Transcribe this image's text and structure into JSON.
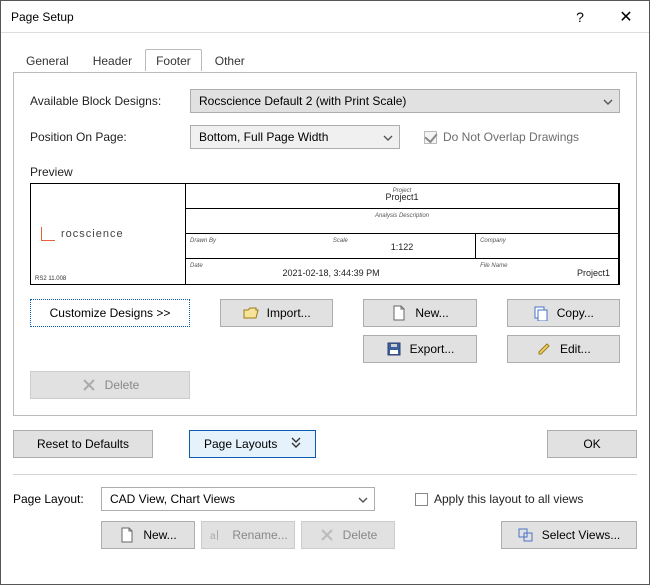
{
  "window": {
    "title": "Page Setup"
  },
  "tabs": {
    "general": "General",
    "header": "Header",
    "footer": "Footer",
    "other": "Other"
  },
  "footerTab": {
    "availableLabel": "Available Block Designs:",
    "availableValue": "Rocscience Default 2 (with Print Scale)",
    "positionLabel": "Position On Page:",
    "positionValue": "Bottom, Full Page Width",
    "doNotOverlap": "Do Not Overlap Drawings",
    "previewLabel": "Preview",
    "preview": {
      "logoText": "rocscience",
      "cornerTiny": "RS2 11.008",
      "projectLbl": "Project",
      "projectVal": "Project1",
      "analysisLbl": "Analysis Description",
      "drawnByLbl": "Drawn By",
      "scaleLbl": "Scale",
      "scaleVal": "1:122",
      "companyLbl": "Company",
      "dateLbl": "Date",
      "dateVal": "2021-02-18, 3:44:39 PM",
      "fileNameLbl": "File Name",
      "fileNameVal": "Project1"
    },
    "buttons": {
      "customize": "Customize Designs >>",
      "import": "Import...",
      "new": "New...",
      "copy": "Copy...",
      "export": "Export...",
      "edit": "Edit...",
      "delete": "Delete"
    }
  },
  "lower": {
    "reset": "Reset to Defaults",
    "pageLayouts": "Page Layouts",
    "ok": "OK",
    "pageLayoutLabel": "Page Layout:",
    "pageLayoutValue": "CAD View, Chart Views",
    "applyAll": "Apply this layout to all views",
    "new": "New...",
    "rename": "Rename...",
    "delete": "Delete",
    "selectViews": "Select Views..."
  }
}
